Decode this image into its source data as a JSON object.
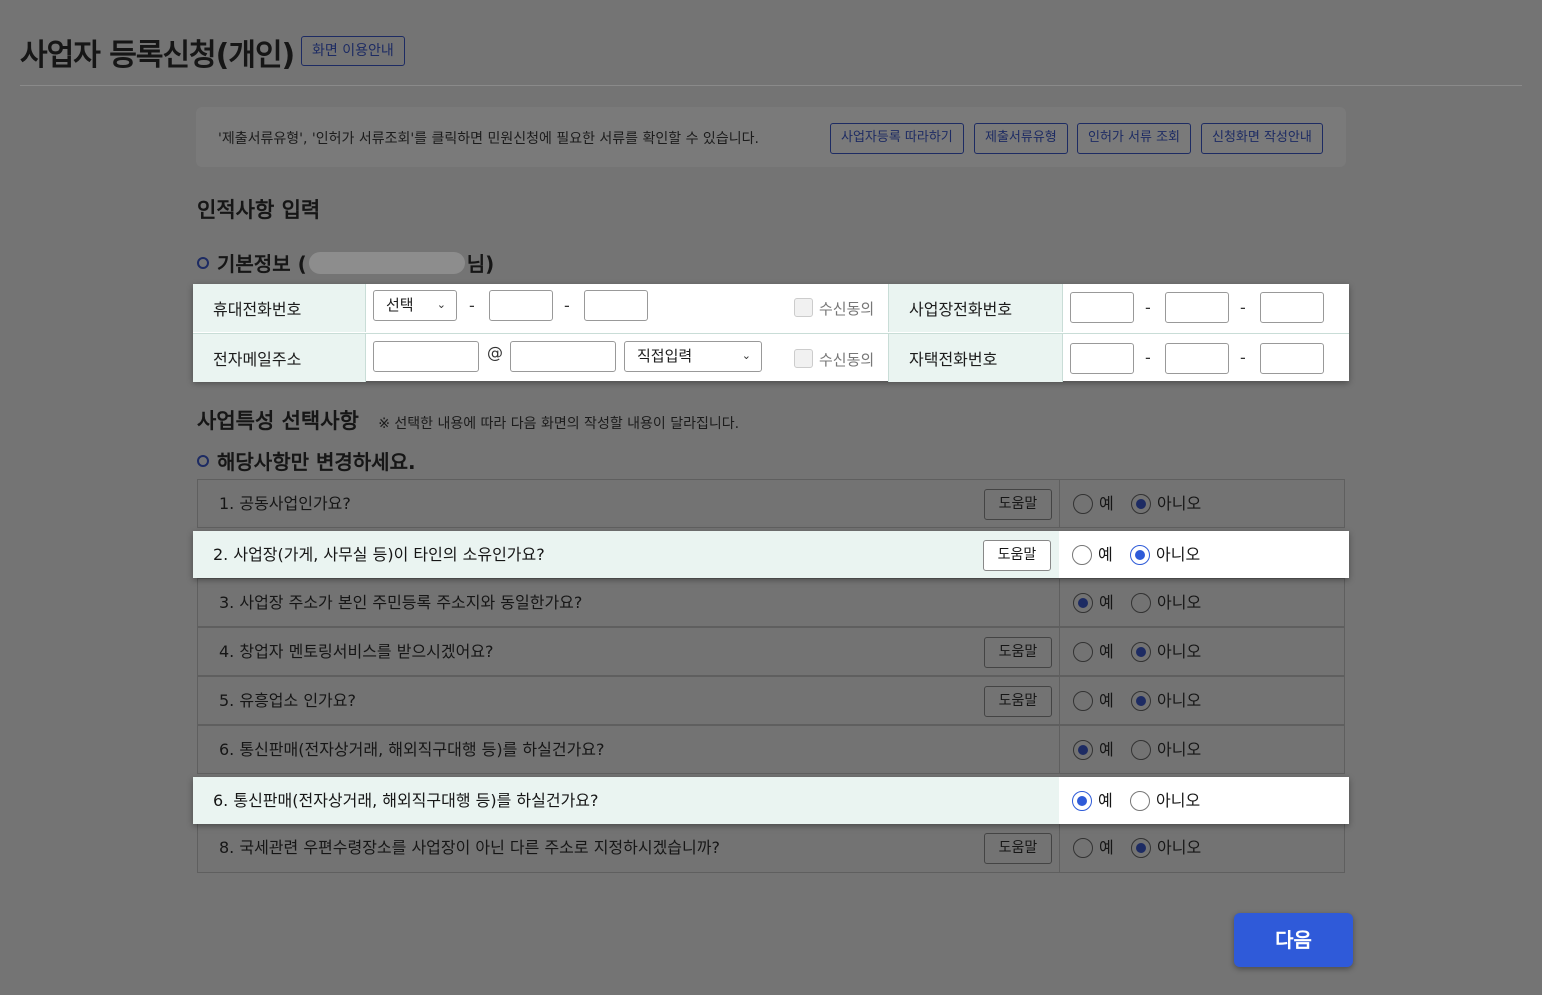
{
  "page": {
    "title": "사업자 등록신청(개인)",
    "guide_label": "화면 이용안내"
  },
  "info": {
    "text": "'제출서류유형', '인허가 서류조회'를 클릭하면 민원신청에 필요한 서류를 확인할 수 있습니다.",
    "buttons": [
      "사업자등록 따라하기",
      "제출서류유형",
      "인허가 서류 조회",
      "신청화면 작성안내"
    ]
  },
  "personal": {
    "heading": "인적사항 입력",
    "basic_prefix": "기본정보 (",
    "basic_suffix": "님)",
    "mobile_label": "휴대전화번호",
    "mobile_select": "선택",
    "consent_label": "수신동의",
    "biz_phone_label": "사업장전화번호",
    "email_label": "전자메일주소",
    "email_at": "@",
    "email_domain_select": "직접입력",
    "home_phone_label": "자택전화번호",
    "dash": "-"
  },
  "business": {
    "heading": "사업특성 선택사항",
    "note": "※ 선택한 내용에 따라 다음 화면의 작성할 내용이 달라집니다.",
    "sub_heading": "해당사항만 변경하세요.",
    "help_label": "도움말",
    "yes_label": "예",
    "no_label": "아니오",
    "questions": [
      {
        "text": "1. 공동사업인가요?",
        "help": true,
        "answer": "no"
      },
      {
        "text": "2. 사업장(가게, 사무실 등)이 타인의 소유인가요?",
        "help": true,
        "answer": "no",
        "highlight": true
      },
      {
        "text": "3. 사업장 주소가 본인 주민등록 주소지와 동일한가요?",
        "help": false,
        "answer": "yes"
      },
      {
        "text": "4. 창업자 멘토링서비스를 받으시겠어요?",
        "help": true,
        "answer": "no"
      },
      {
        "text": "5. 유흥업소 인가요?",
        "help": true,
        "answer": "no"
      },
      {
        "text": "6. 통신판매(전자상거래, 해외직구대행 등)를 하실건가요?",
        "help": false,
        "answer": "yes"
      },
      {
        "text": "6. 통신판매(전자상거래, 해외직구대행 등)를 하실건가요?",
        "help": false,
        "answer": "yes",
        "highlight": true
      },
      {
        "text": "8. 국세관련 우편수령장소를 사업장이 아닌 다른 주소로 지정하시겠습니까?",
        "help": true,
        "answer": "no"
      }
    ]
  },
  "next_label": "다음"
}
